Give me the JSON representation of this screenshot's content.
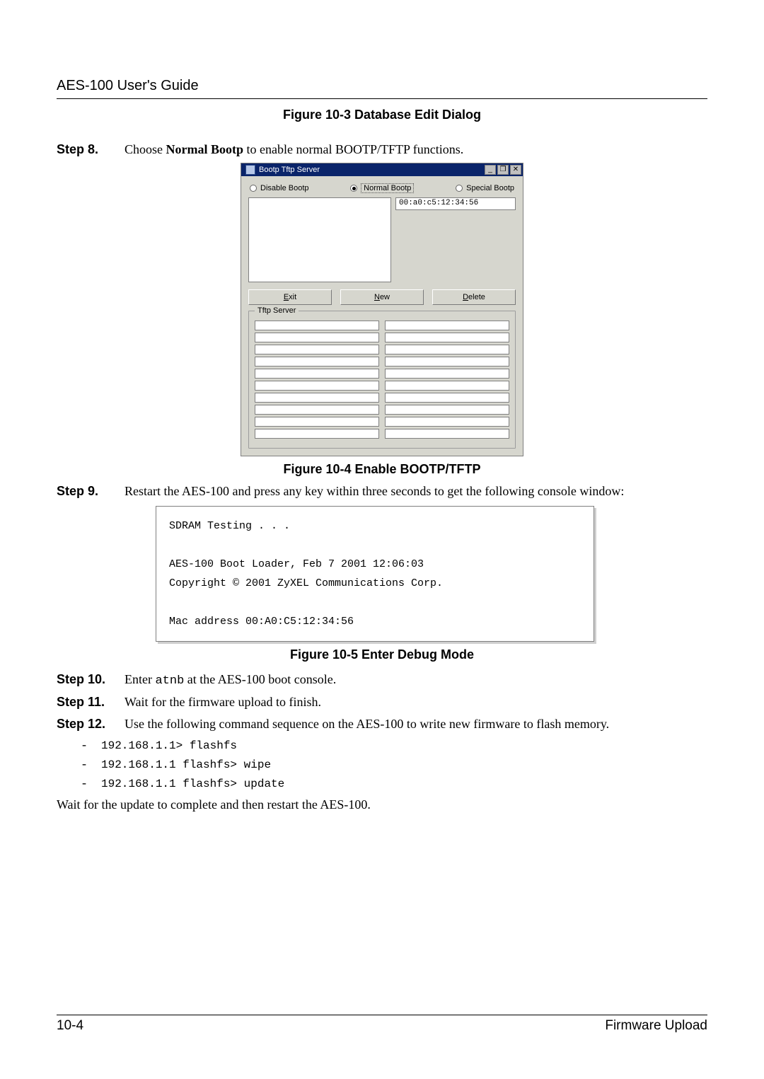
{
  "header": {
    "title": "AES-100 User's Guide"
  },
  "figures": {
    "fig10_3": "Figure 10-3 Database Edit Dialog",
    "fig10_4": "Figure 10-4 Enable BOOTP/TFTP",
    "fig10_5": "Figure 10-5 Enter Debug Mode"
  },
  "steps": {
    "s8": {
      "label": "Step 8.",
      "prefix": "Choose ",
      "bold": "Normal Bootp",
      "suffix": " to enable normal BOOTP/TFTP functions."
    },
    "s9": {
      "label": "Step 9.",
      "text": "Restart the AES-100 and press any key within three seconds to get the following console window:"
    },
    "s10": {
      "label": "Step 10.",
      "prefix": "Enter ",
      "tt": "atnb",
      "suffix": " at the AES-100 boot console."
    },
    "s11": {
      "label": "Step 11.",
      "text": "Wait for the firmware upload to finish."
    },
    "s12": {
      "label": "Step 12.",
      "text": "Use the following command sequence on the AES-100 to write new firmware to flash memory."
    }
  },
  "bootp_window": {
    "title": "Bootp Tftp Server",
    "radios": {
      "disable": "Disable Bootp",
      "normal": "Normal Bootp",
      "special": "Special Bootp"
    },
    "selected_radio": "normal",
    "mac_value": "00:a0:c5:12:34:56",
    "buttons": {
      "exit_u": "E",
      "exit_rest": "xit",
      "new_u": "N",
      "new_rest": "ew",
      "delete_u": "D",
      "delete_rest": "elete"
    },
    "group_title": "Tftp Server",
    "win_btn_min": "_",
    "win_btn_max": "❐",
    "win_btn_close": "✕"
  },
  "console": {
    "l1": "SDRAM Testing . . .",
    "l2": "",
    "l3": "AES-100 Boot Loader, Feb 7 2001 12:06:03",
    "l4": "Copyright © 2001 ZyXEL Communications Corp.",
    "l5": "",
    "l6": "Mac address 00:A0:C5:12:34:56"
  },
  "commands": {
    "c1": "192.168.1.1> flashfs",
    "c2": "192.168.1.1 flashfs> wipe",
    "c3": "192.168.1.1 flashfs> update"
  },
  "closing": "Wait for the update to complete and then restart the AES-100.",
  "footer": {
    "page_num": "10-4",
    "section": "Firmware Upload"
  }
}
